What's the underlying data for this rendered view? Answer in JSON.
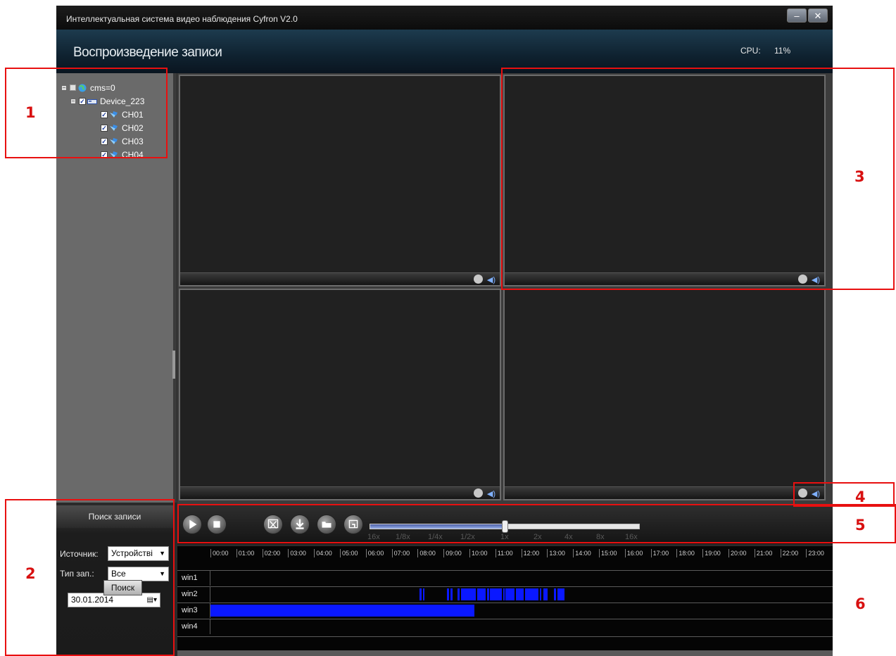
{
  "window": {
    "title": "Интеллектуальная система видео наблюдения Cyfron V2.0",
    "minimize_glyph": "–",
    "close_glyph": "✕"
  },
  "header": {
    "page_title": "Воспроизведение записи",
    "cpu_label": "CPU:",
    "cpu_value": "11%"
  },
  "device_tree": {
    "root": {
      "label": "cms=0",
      "icon": "globe-icon"
    },
    "device": {
      "label": "Device_223",
      "icon": "dvr-device-icon",
      "checked": true
    },
    "channels": [
      {
        "label": "CH01",
        "icon": "camera-icon",
        "checked": true
      },
      {
        "label": "CH02",
        "icon": "camera-icon",
        "checked": true
      },
      {
        "label": "CH03",
        "icon": "camera-icon",
        "checked": true
      },
      {
        "label": "CH04",
        "icon": "camera-icon",
        "checked": true
      }
    ]
  },
  "search_panel": {
    "title": "Поиск записи",
    "source_label": "Источник:",
    "source_value": "Устройстві",
    "type_label": "Тип зап.:",
    "type_value": "Все",
    "date_value": "30.01.2014",
    "search_button": "Поиск"
  },
  "controls": {
    "buttons": [
      "play-icon",
      "stop-icon",
      "clip-icon",
      "download-icon",
      "folder-icon",
      "snapshot-icon"
    ],
    "speed_labels": [
      "16x",
      "1/8x",
      "1/4x",
      "1/2x",
      "1x",
      "2x",
      "4x",
      "8x",
      "16x"
    ],
    "speed_selected": "1x"
  },
  "timeline": {
    "hours": [
      "00:00",
      "01:00",
      "02:00",
      "03:00",
      "04:00",
      "05:00",
      "06:00",
      "07:00",
      "08:00",
      "09:00",
      "10:00",
      "11:00",
      "12:00",
      "13:00",
      "14:00",
      "15:00",
      "16:00",
      "17:00",
      "18:00",
      "19:00",
      "20:00",
      "21:00",
      "22:00",
      "23:00"
    ],
    "rows": [
      {
        "name": "win1",
        "segments_hours": []
      },
      {
        "name": "win2",
        "segments_hours": [
          [
            8.08,
            8.15
          ],
          [
            8.2,
            8.27
          ],
          [
            9.12,
            9.22
          ],
          [
            9.27,
            9.35
          ],
          [
            9.55,
            9.62
          ],
          [
            9.68,
            10.25
          ],
          [
            10.3,
            10.62
          ],
          [
            10.68,
            10.75
          ],
          [
            10.8,
            11.25
          ],
          [
            11.3,
            11.33
          ],
          [
            11.38,
            11.75
          ],
          [
            11.8,
            12.1
          ],
          [
            12.15,
            12.65
          ],
          [
            12.72,
            12.78
          ],
          [
            12.85,
            13.02
          ],
          [
            13.25,
            13.33
          ],
          [
            13.4,
            13.68
          ]
        ]
      },
      {
        "name": "win3",
        "segments_hours": [
          [
            0.0,
            10.2
          ]
        ]
      },
      {
        "name": "win4",
        "segments_hours": []
      }
    ],
    "segment_color": "#0a18ff"
  },
  "annotations": [
    "1",
    "2",
    "3",
    "4",
    "5",
    "6"
  ],
  "colors": {
    "annotation": "#e81010",
    "record": "#0a18ff"
  }
}
